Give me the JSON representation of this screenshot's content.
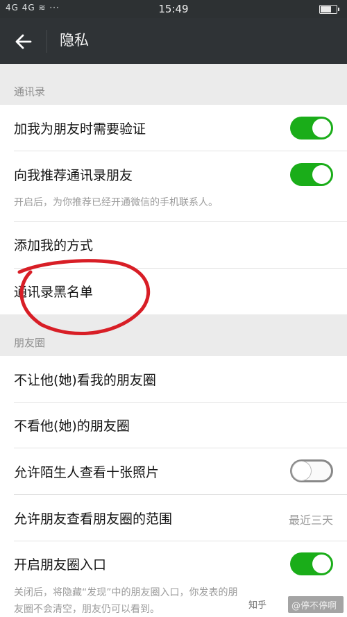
{
  "status": {
    "signal": "4G 4G ≋ ···",
    "time": "15:49",
    "battery_level": 0.7
  },
  "header": {
    "title": "隐私"
  },
  "sections": {
    "contacts": {
      "label": "通讯录",
      "add_verify": "加我为朋友时需要验证",
      "recommend": "向我推荐通讯录朋友",
      "recommend_sub": "开启后，为你推荐已经开通微信的手机联系人。",
      "add_methods": "添加我的方式",
      "blacklist": "通讯录黑名单"
    },
    "moments": {
      "label": "朋友圈",
      "hide_from": "不让他(她)看我的朋友圈",
      "not_see": "不看他(她)的朋友圈",
      "strangers": "允许陌生人查看十张照片",
      "range": "允许朋友查看朋友圈的范围",
      "range_value": "最近三天",
      "entry": "开启朋友圈入口",
      "entry_sub1": "关闭后，将隐藏“发现”中的朋友圈入口，你发表的朋",
      "entry_sub2": "友圈不会清空，朋友仍可以看到。"
    }
  },
  "toggles": {
    "add_verify": true,
    "recommend": true,
    "strangers": false,
    "entry": true
  },
  "colors": {
    "toggle_on": "#1aad19",
    "annotation": "#d81e26",
    "header_bg": "#2f3336"
  },
  "watermark": {
    "text": "知乎",
    "author": "@停不停啊"
  }
}
